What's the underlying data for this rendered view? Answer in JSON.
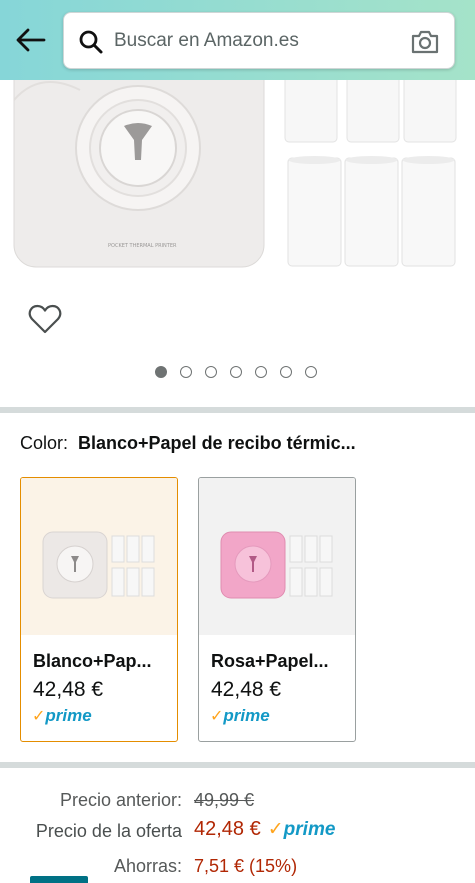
{
  "search": {
    "placeholder": "Buscar en Amazon.es"
  },
  "product_image": {
    "label_on_device": "POCKET THERMAL PRINTER"
  },
  "carousel": {
    "count": 7,
    "active_index": 0
  },
  "color": {
    "label": "Color:",
    "selected_value": "Blanco+Papel de recibo térmic..."
  },
  "variants": [
    {
      "name": "Blanco+Pap...",
      "price": "42,48 €",
      "prime": "prime",
      "selected": true,
      "swatch": "#ece8e6"
    },
    {
      "name": "Rosa+Papel...",
      "price": "42,48 €",
      "prime": "prime",
      "selected": false,
      "swatch": "#f2a6c8"
    }
  ],
  "pricing": {
    "previous_label": "Precio anterior:",
    "previous_value": "49,99 €",
    "deal_label": "Precio de la oferta",
    "deal_value": "42,48 €",
    "prime": "prime",
    "savings_label": "Ahorras:",
    "savings_value": "7,51 € (15%)"
  },
  "colors": {
    "accent": "#007185",
    "price_red": "#B12704",
    "prime_blue": "#1399C6",
    "selected_border": "#E48D00"
  }
}
